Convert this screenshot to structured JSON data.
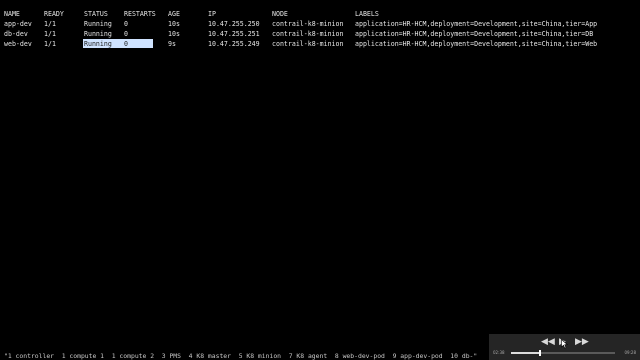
{
  "terminal": {
    "headers": {
      "name": "NAME",
      "ready": "READY",
      "status": "STATUS",
      "restarts": "RESTARTS",
      "age": "AGE",
      "ip": "IP",
      "node": "NODE",
      "labels": "LABELS"
    },
    "rows": [
      {
        "name": "app-dev",
        "ready": "1/1",
        "status": "Running",
        "restarts": "0",
        "age": "10s",
        "ip": "10.47.255.250",
        "node": "contrail-k8-minion",
        "labels": "application=HR-HCM,deployment=Development,site=China,tier=App"
      },
      {
        "name": "db-dev",
        "ready": "1/1",
        "status": "Running",
        "restarts": "0",
        "age": "10s",
        "ip": "10.47.255.251",
        "node": "contrail-k8-minion",
        "labels": "application=HR-HCM,deployment=Development,site=China,tier=DB"
      },
      {
        "name": "web-dev",
        "ready": "1/1",
        "status": "Running",
        "restarts": "0",
        "age": "9s",
        "ip": "10.47.255.249",
        "node": "contrail-k8-minion",
        "labels": "application=HR-HCM,deployment=Development,site=China,tier=Web"
      }
    ],
    "status_line": "\"1 controller  1 compute 1  1 compute 2  3 PMS  4 K8 master  5 K8 minion  7 K8 agent  8 web-dev-pod  9 app-dev-pod  10 db-\"",
    "selection_color": "#cfe3ff"
  },
  "player": {
    "current_time": "02:38",
    "total_time": "09:28",
    "progress": 0.28,
    "rewind_icon": "rewind-icon",
    "play_icon": "play-icon",
    "fast_forward_icon": "fast-forward-icon",
    "glyphs": {
      "rewind": "◀◀",
      "play": "▶",
      "fast_forward": "▶▶"
    }
  }
}
